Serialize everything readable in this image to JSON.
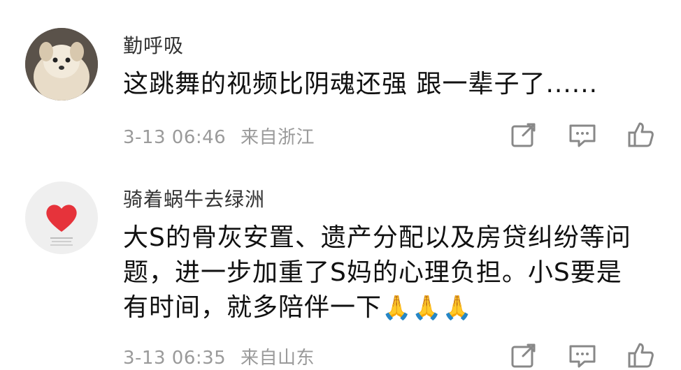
{
  "comments": [
    {
      "username": "勤呼吸",
      "content": "这跳舞的视频比阴魂还强 跟一辈子了......",
      "date": "3-13 06:46",
      "location": "来自浙江",
      "avatar_icon": "dog-photo-avatar"
    },
    {
      "username": "骑着蜗牛去绿洲",
      "content_lines": [
        "大S的骨灰安置、遗产分配以及房贷纠纷等问",
        "题，进一步加重了S妈的心理负担。小S要是",
        "有时间，就多陪伴一下"
      ],
      "emojis": "🙏🙏🙏",
      "date": "3-13 06:35",
      "location": "来自山东",
      "avatar_icon": "heart-avatar"
    }
  ],
  "icons": {
    "share": "share-icon",
    "comment": "comment-icon",
    "like": "thumbs-up-icon"
  }
}
